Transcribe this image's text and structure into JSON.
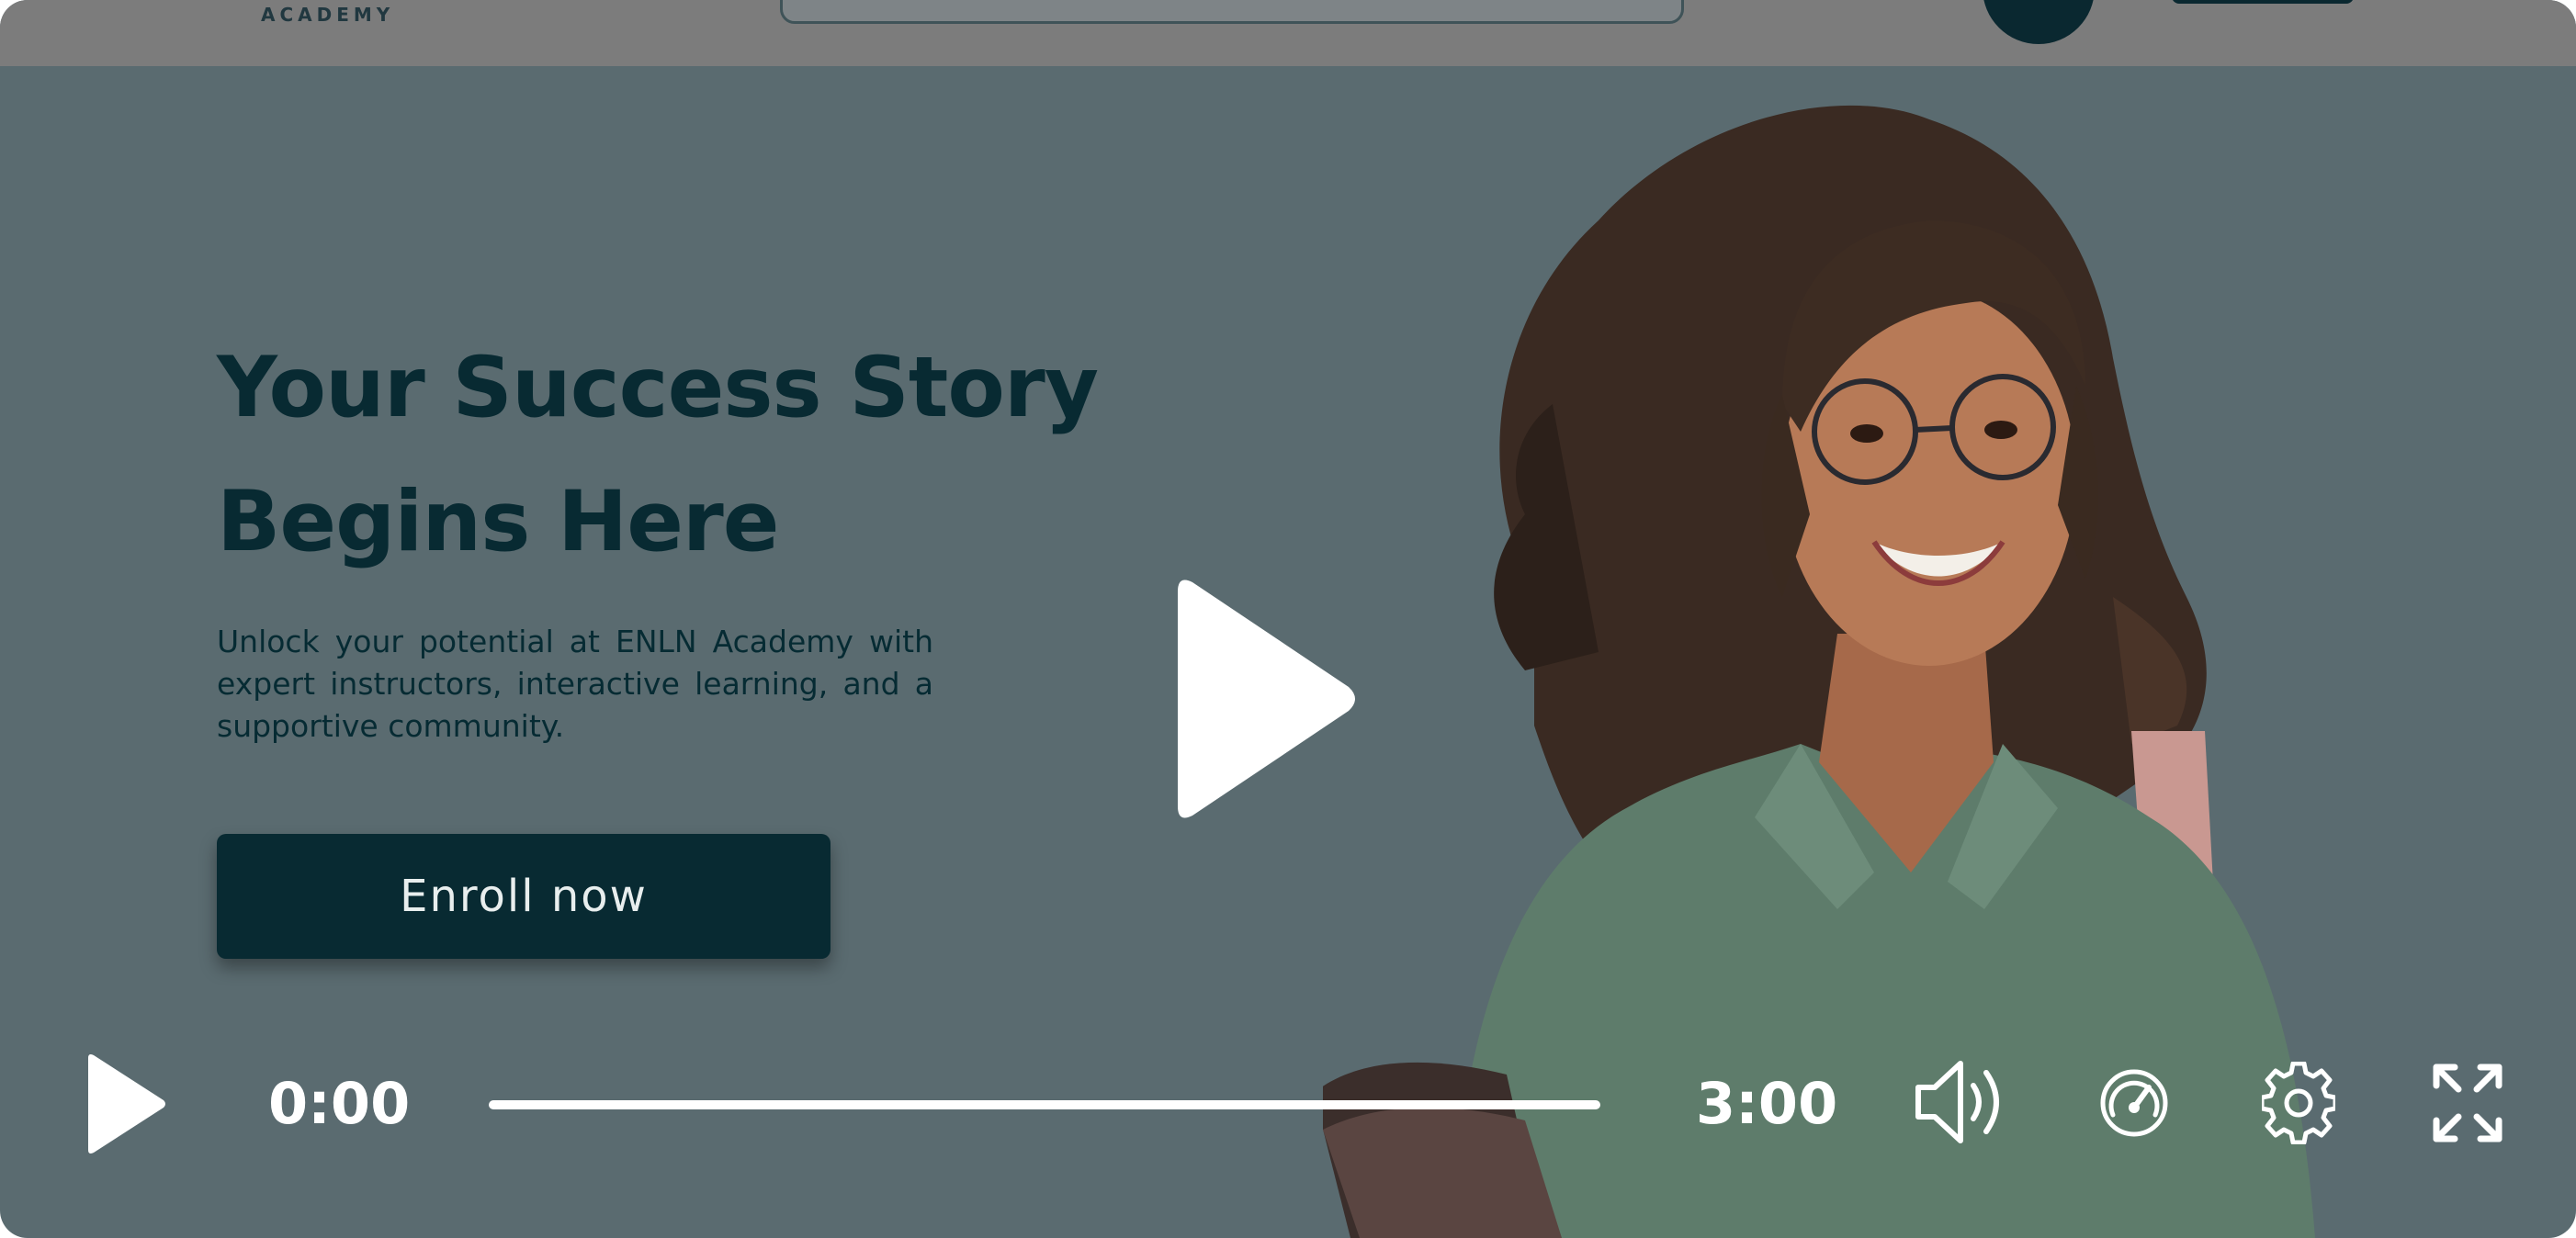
{
  "header": {
    "logo_subtitle": "ACADEMY"
  },
  "hero": {
    "title_line1": "Your Success Story",
    "title_line2": "Begins Here",
    "subtitle": "Unlock your potential at ENLN Academy with expert instructors, interactive learning, and a supportive community.",
    "cta_label": "Enroll now"
  },
  "player": {
    "current_time": "0:00",
    "total_time": "3:00",
    "progress": 0,
    "icons": {
      "center": "play-icon",
      "play": "play-icon",
      "volume": "volume-icon",
      "speed": "speedometer-icon",
      "settings": "gear-icon",
      "fullscreen": "fullscreen-icon"
    }
  },
  "colors": {
    "overlay": "#5a6b70",
    "topbar": "#7c7c7c",
    "brand_dark": "#082a32",
    "control_white": "#ffffff"
  }
}
